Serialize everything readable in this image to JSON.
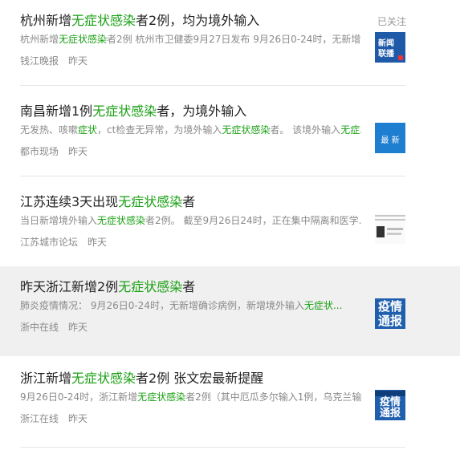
{
  "followed_label": "已关注",
  "colors": {
    "keyword": "#1aa014",
    "highlight_bg": "#f0f0f0",
    "meta": "#8a8a8a"
  },
  "items": [
    {
      "title_pre": "杭州新增",
      "title_hit": "无症状感染",
      "title_post": "者2例，均为境外输入",
      "summary_pre": "杭州新增",
      "summary_hit": "无症状感染",
      "summary_post": "者2例 杭州市卫健委9月27日发布 9月26日0-24时，无新增...",
      "source": "钱江晚报",
      "time": "昨天",
      "thumb_line1": "新闻",
      "thumb_line2": "联播"
    },
    {
      "title_pre": "南昌新增1例",
      "title_hit": "无症状感染",
      "title_post": "者，为境外输入",
      "summary_pre": "无发热、咳嗽",
      "summary_hit": "症状",
      "summary_mid": "，ct检查无异常，为境外输入",
      "summary_hit2": "无症状感染",
      "summary_post": "者。 该境外输入",
      "summary_hit3": "无症...",
      "source": "都市现场",
      "time": "昨天",
      "thumb_text": "最 新"
    },
    {
      "title_pre": "江苏连续3天出现",
      "title_hit": "无症状感染",
      "title_post": "者",
      "summary_pre": "当日新增境外输入",
      "summary_hit": "无症状感染",
      "summary_post": "者2例。 截至9月26日24时，正在集中隔离和医学...",
      "source": "江苏城市论坛",
      "time": "昨天"
    },
    {
      "title_pre": "昨天浙江新增2例",
      "title_hit": "无症状感染",
      "title_post": "者",
      "summary_pre": "肺炎疫情情况： 9月26日0-24时，无新增确诊病例，新增境外输入",
      "summary_hit": "无症状...",
      "summary_post": "",
      "source": "浙中在线",
      "time": "昨天",
      "thumb_row1": "疫情",
      "thumb_row2": "通报"
    },
    {
      "title_pre": "浙江新增",
      "title_hit": "无症状感染",
      "title_post": "者2例 张文宏最新提醒",
      "summary_pre": "9月26日0-24时，浙江新增",
      "summary_hit": "无症状感染",
      "summary_post": "者2例（其中厄瓜多尔输入1例，乌克兰输...",
      "source": "浙江在线",
      "time": "昨天",
      "thumb_row1": "疫情",
      "thumb_row2": "通报"
    }
  ]
}
